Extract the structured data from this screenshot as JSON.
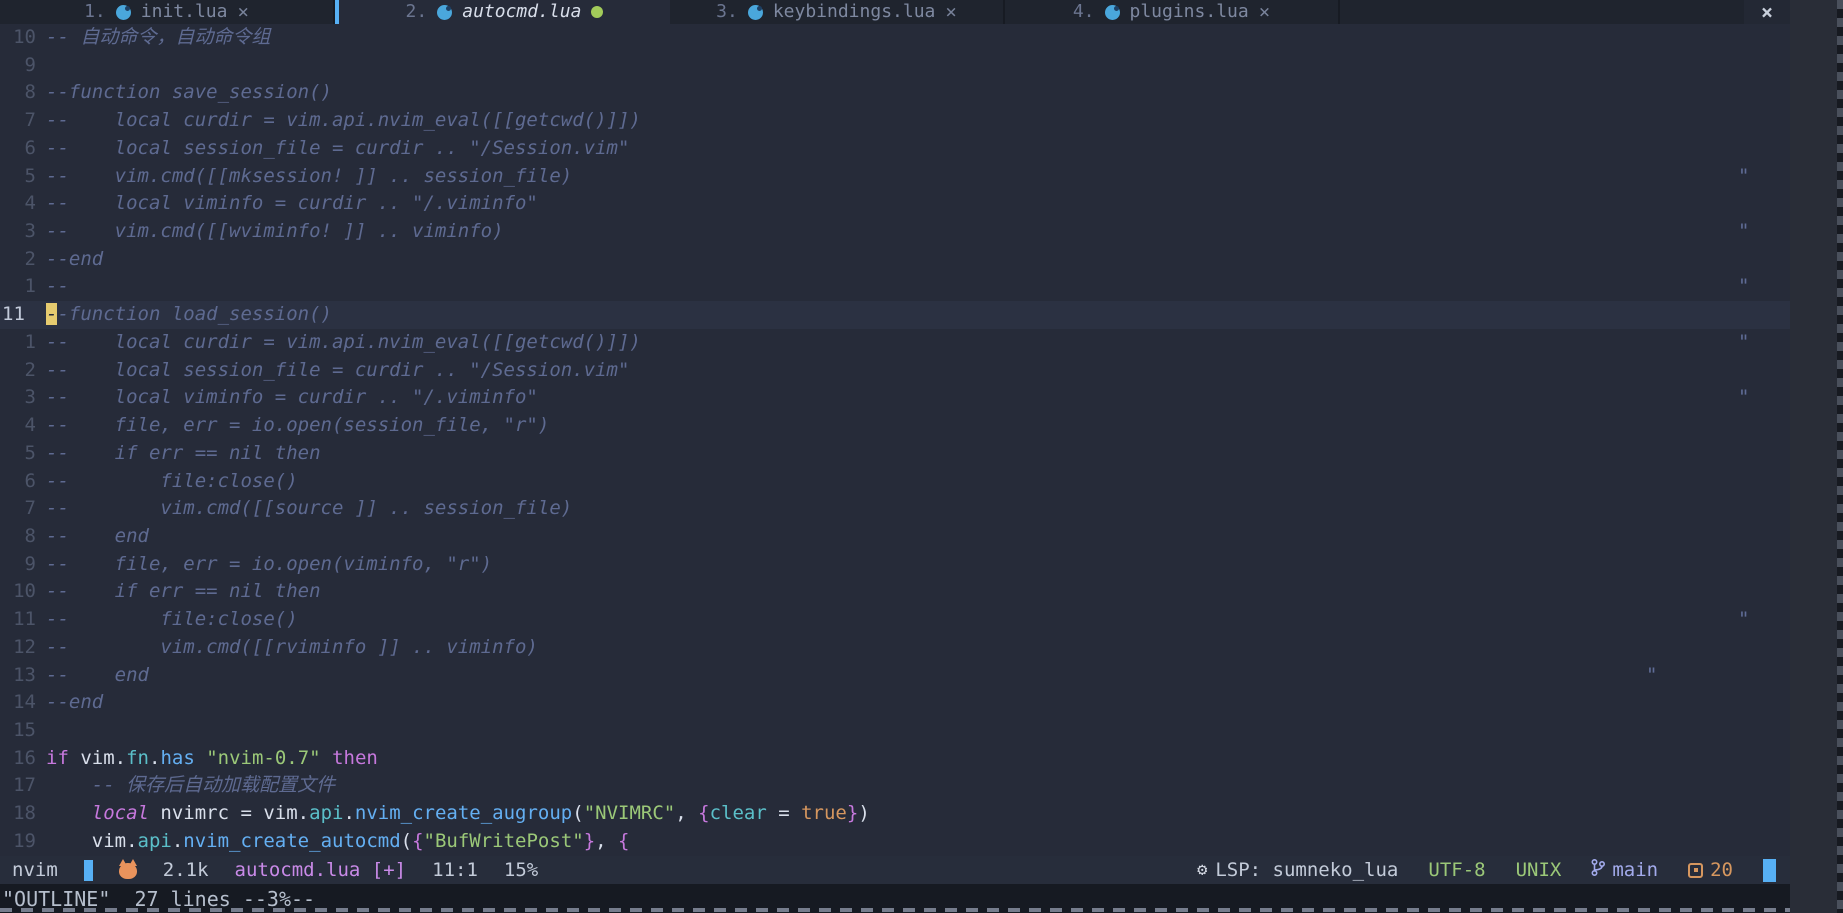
{
  "colors": {
    "background": "#262b39",
    "cursorline": "#2b3142",
    "tabbar_bg": "#1f242e",
    "accent_blue": "#57b0f4",
    "comment": "#5e6a91",
    "foreground": "#d9dfeb",
    "keyword_purple": "#c678dd",
    "string_green": "#9bc878",
    "teal": "#5bbfc9",
    "func_blue": "#64aff2",
    "orange": "#d6975f",
    "cursor_yellow": "#e6cb6f",
    "modified_green": "#a2cb5a",
    "file_purple": "#c98ae8",
    "branch_lavender": "#a3abec"
  },
  "tabbar": {
    "tabs": [
      {
        "index": "1.",
        "name": "init.lua",
        "icon": "lua-icon",
        "close": "×",
        "active": false,
        "modified": false
      },
      {
        "index": "2.",
        "name": "autocmd.lua",
        "icon": "lua-icon",
        "close": "",
        "active": true,
        "modified": true
      },
      {
        "index": "3.",
        "name": "keybindings.lua",
        "icon": "lua-icon",
        "close": "×",
        "active": false,
        "modified": false
      },
      {
        "index": "4.",
        "name": "plugins.lua",
        "icon": "lua-icon",
        "close": "×",
        "active": false,
        "modified": false
      }
    ],
    "close_all": "×"
  },
  "editor": {
    "eol_mark_char": "\"",
    "lines": [
      {
        "n": "10",
        "t": [
          [
            "com",
            "-- 自动命令，自动命令组"
          ]
        ]
      },
      {
        "n": "9",
        "t": []
      },
      {
        "n": "8",
        "t": [
          [
            "com",
            "--function save_session()"
          ]
        ]
      },
      {
        "n": "7",
        "t": [
          [
            "com",
            "--    local curdir = vim.api.nvim_eval([[getcwd()]])"
          ]
        ]
      },
      {
        "n": "6",
        "t": [
          [
            "com",
            "--    local session_file = curdir .. \"/Session.vim\""
          ]
        ]
      },
      {
        "n": "5",
        "t": [
          [
            "com",
            "--    vim.cmd([[mksession! ]] .. session_file)"
          ]
        ],
        "eol": 1738
      },
      {
        "n": "4",
        "t": [
          [
            "com",
            "--    local viminfo = curdir .. \"/.viminfo\""
          ]
        ]
      },
      {
        "n": "3",
        "t": [
          [
            "com",
            "--    vim.cmd([[wviminfo! ]] .. viminfo)"
          ]
        ],
        "eol": 1738
      },
      {
        "n": "2",
        "t": [
          [
            "com",
            "--end"
          ]
        ]
      },
      {
        "n": "1",
        "t": [
          [
            "com",
            "--"
          ]
        ],
        "eol": 1738
      },
      {
        "n": "11",
        "cur": true,
        "t": [
          [
            "cursor",
            "-"
          ],
          [
            "com",
            "-function load_session()"
          ]
        ]
      },
      {
        "n": "1",
        "t": [
          [
            "com",
            "--    local curdir = vim.api.nvim_eval([[getcwd()]])"
          ]
        ],
        "eol": 1738
      },
      {
        "n": "2",
        "t": [
          [
            "com",
            "--    local session_file = curdir .. \"/Session.vim\""
          ]
        ]
      },
      {
        "n": "3",
        "t": [
          [
            "com",
            "--    local viminfo = curdir .. \"/.viminfo\""
          ]
        ],
        "eol": 1738
      },
      {
        "n": "4",
        "t": [
          [
            "com",
            "--    file, err = io.open(session_file, \"r\")"
          ]
        ]
      },
      {
        "n": "5",
        "t": [
          [
            "com",
            "--    if err == nil then"
          ]
        ]
      },
      {
        "n": "6",
        "t": [
          [
            "com",
            "--        file:close()"
          ]
        ]
      },
      {
        "n": "7",
        "t": [
          [
            "com",
            "--        vim.cmd([[source ]] .. session_file)"
          ]
        ]
      },
      {
        "n": "8",
        "t": [
          [
            "com",
            "--    end"
          ]
        ]
      },
      {
        "n": "9",
        "t": [
          [
            "com",
            "--    file, err = io.open(viminfo, \"r\")"
          ]
        ]
      },
      {
        "n": "10",
        "t": [
          [
            "com",
            "--    if err == nil then"
          ]
        ]
      },
      {
        "n": "11",
        "t": [
          [
            "com",
            "--        file:close()"
          ]
        ],
        "eol": 1738
      },
      {
        "n": "12",
        "t": [
          [
            "com",
            "--        vim.cmd([[rviminfo ]] .. viminfo)"
          ]
        ]
      },
      {
        "n": "13",
        "t": [
          [
            "com",
            "--    end"
          ]
        ],
        "eol": 1646
      },
      {
        "n": "14",
        "t": [
          [
            "com",
            "--end"
          ]
        ]
      },
      {
        "n": "15",
        "t": []
      },
      {
        "n": "16",
        "t": [
          [
            "kw",
            "if"
          ],
          [
            "fg",
            " vim."
          ],
          [
            "teal",
            "fn"
          ],
          [
            "fg",
            "."
          ],
          [
            "blue",
            "has"
          ],
          [
            "fg",
            " "
          ],
          [
            "str",
            "\"nvim-0.7\""
          ],
          [
            "fg",
            " "
          ],
          [
            "kw",
            "then"
          ]
        ]
      },
      {
        "n": "17",
        "t": [
          [
            "com",
            "    -- 保存后自动加载配置文件"
          ]
        ]
      },
      {
        "n": "18",
        "t": [
          [
            "fg",
            "    "
          ],
          [
            "kwi",
            "local"
          ],
          [
            "fg",
            " nvimrc = vim."
          ],
          [
            "teal",
            "api"
          ],
          [
            "fg",
            "."
          ],
          [
            "blue",
            "nvim_create_augroup"
          ],
          [
            "fg",
            "("
          ],
          [
            "str",
            "\"NVIMRC\""
          ],
          [
            "fg",
            ", "
          ],
          [
            "kw",
            "{"
          ],
          [
            "teal",
            "clear"
          ],
          [
            "fg",
            " = "
          ],
          [
            "orange",
            "true"
          ],
          [
            "kw",
            "}"
          ],
          [
            "fg",
            ")"
          ]
        ]
      },
      {
        "n": "19",
        "t": [
          [
            "fg",
            "    vim."
          ],
          [
            "teal",
            "api"
          ],
          [
            "fg",
            "."
          ],
          [
            "blue",
            "nvim_create_autocmd"
          ],
          [
            "fg",
            "("
          ],
          [
            "kw",
            "{"
          ],
          [
            "str",
            "\"BufWritePost\""
          ],
          [
            "kw",
            "}"
          ],
          [
            "fg",
            ", "
          ],
          [
            "kw",
            "{"
          ]
        ]
      }
    ]
  },
  "statusline": {
    "left": [
      {
        "kind": "text",
        "name": "mode-label",
        "text": "nvim"
      },
      {
        "kind": "bar",
        "name": "cursor-block-icon"
      },
      {
        "kind": "cat",
        "name": "cat-icon"
      },
      {
        "kind": "text",
        "name": "buffer-count",
        "text": "2.1k"
      },
      {
        "kind": "text",
        "name": "filename-label",
        "text": "autocmd.lua [+]",
        "cls": "st-file"
      },
      {
        "kind": "text",
        "name": "cursor-position",
        "text": "11:1"
      },
      {
        "kind": "text",
        "name": "scroll-percent",
        "text": "15%"
      }
    ],
    "right": [
      {
        "kind": "lsp",
        "name": "lsp-status",
        "icon": "⚙",
        "text": "LSP: sumneko_lua"
      },
      {
        "kind": "text",
        "name": "file-encoding",
        "text": "UTF-8",
        "cls": "st-green"
      },
      {
        "kind": "text",
        "name": "file-format",
        "text": "UNIX",
        "cls": "st-green"
      },
      {
        "kind": "branch",
        "name": "git-branch",
        "text": "main",
        "cls": "st-lav"
      },
      {
        "kind": "box",
        "name": "tab-size",
        "text": "20",
        "cls": "st-orange"
      },
      {
        "kind": "bar2",
        "name": "right-block-icon"
      }
    ]
  },
  "cmdline": {
    "message": "\"OUTLINE\"  27 lines --3%--"
  }
}
